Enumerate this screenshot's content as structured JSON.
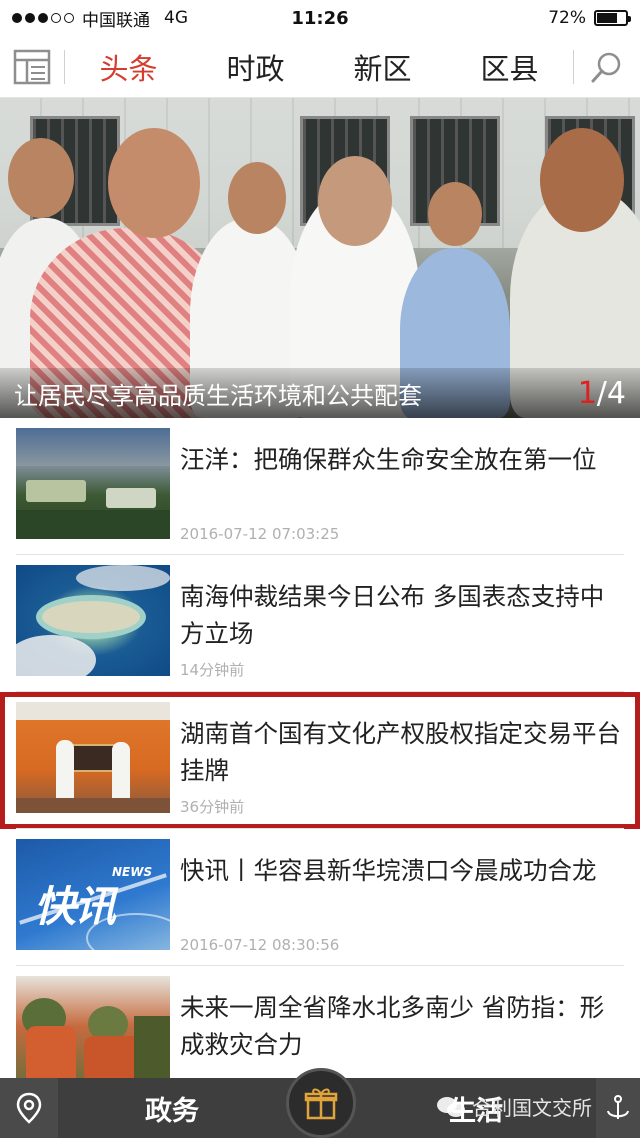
{
  "status_bar": {
    "carrier": "中国联通",
    "network": "4G",
    "time": "11:26",
    "battery": "72%",
    "battery_level": 0.72
  },
  "nav": {
    "tabs": [
      {
        "label": "头条",
        "active": true
      },
      {
        "label": "时政",
        "active": false
      },
      {
        "label": "新区",
        "active": false
      },
      {
        "label": "区县",
        "active": false
      }
    ],
    "icons": {
      "menu": "layout-grid-icon",
      "search": "search-icon"
    },
    "accent_color": "#d43d2e"
  },
  "hero": {
    "caption": "让居民尽享高品质生活环境和公共配套",
    "pager_current": "1",
    "pager_total": "/4"
  },
  "news": [
    {
      "title": "汪洋：把确保群众生命安全放在第一位",
      "time": "2016-07-12 07:03:25"
    },
    {
      "title": "南海仲裁结果今日公布 多国表态支持中方立场",
      "time": "14分钟前"
    },
    {
      "title": "湖南首个国有文化产权股权指定交易平台挂牌",
      "time": "36分钟前"
    },
    {
      "title": "快讯丨华容县新华垸溃口今晨成功合龙",
      "time": "2016-07-12 08:30:56"
    },
    {
      "title": "未来一周全省降水北多南少 省防指：形成救灾合力",
      "time": ""
    }
  ],
  "thumb_text": {
    "kuaixun": "快讯",
    "news": "NEWS"
  },
  "bottom_bar": {
    "left_tab": "政务",
    "right_tab": "生活",
    "icons": {
      "location": "location-pin-icon",
      "center": "gift-icon",
      "right": "anchor-icon"
    }
  },
  "watermark": {
    "text": "合利国文交所"
  }
}
